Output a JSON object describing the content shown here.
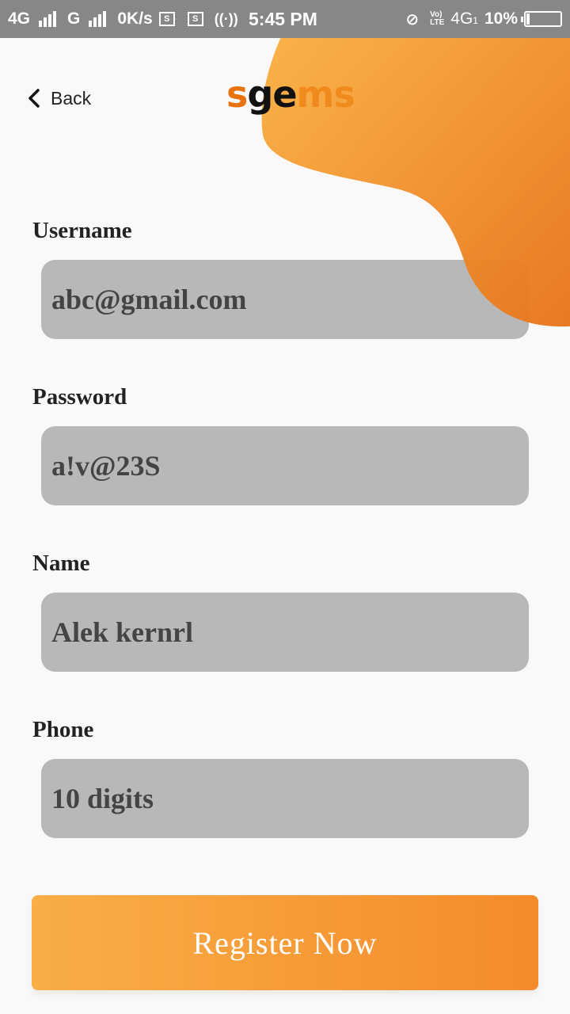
{
  "status_bar": {
    "net1": "4G",
    "net2": "G",
    "speed": "0K/s",
    "box_s": "S",
    "time": "5:45 PM",
    "volte_top": "Vo)",
    "volte_bottom": "LTE",
    "net3": "4G",
    "net3_sub": "1",
    "battery": "10%"
  },
  "header": {
    "back_label": "Back",
    "logo_s": "s",
    "logo_ge": "ge",
    "logo_ms": "ms"
  },
  "form": {
    "username_label": "Username",
    "username_value": "abc@gmail.com",
    "password_label": "Password",
    "password_value": "a!v@23S",
    "name_label": "Name",
    "name_value": "Alek kernrl",
    "phone_label": "Phone",
    "phone_placeholder": "10 digits"
  },
  "actions": {
    "register_label": "Register Now"
  },
  "colors": {
    "accent_light": "#fbb040",
    "accent_dark": "#e8741a",
    "field_bg": "#b8b8b8",
    "statusbar_bg": "#878787"
  }
}
